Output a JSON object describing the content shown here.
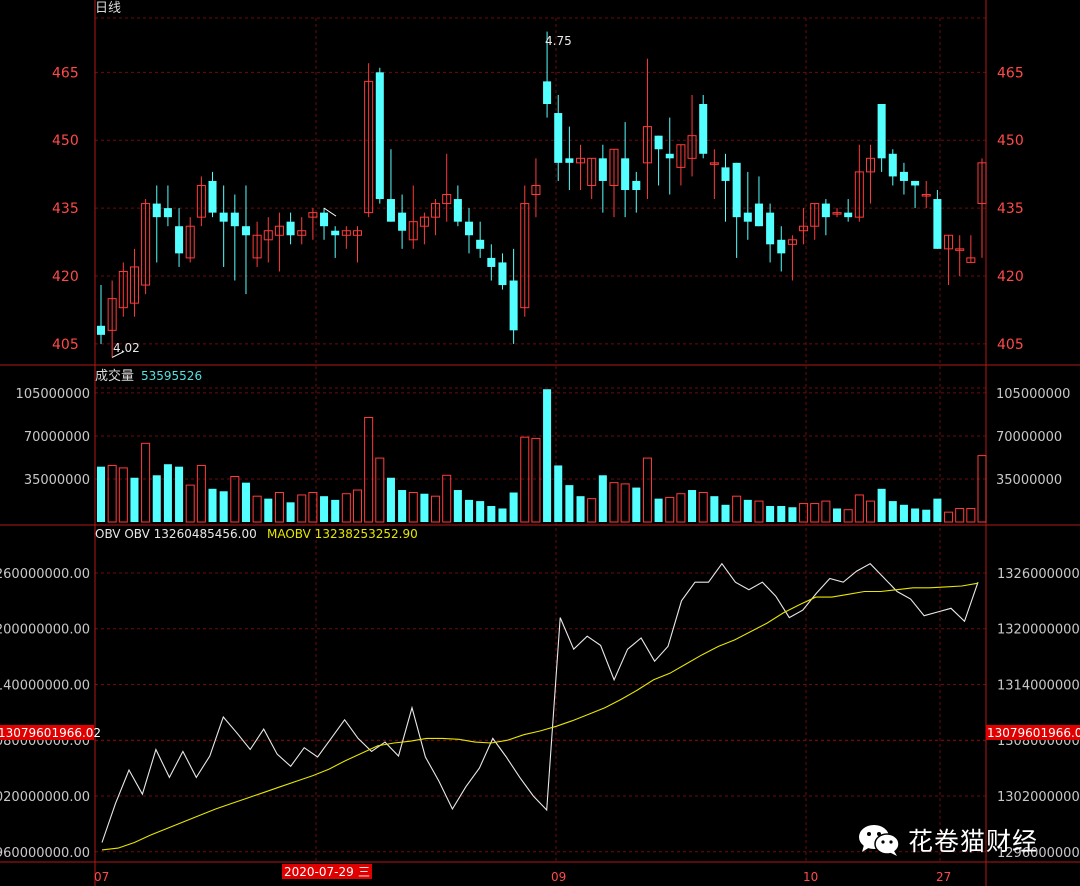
{
  "colors": {
    "up": "#ff3b3b",
    "down": "#54ffff",
    "frame": "#b01818",
    "grid": "#6a0c0c",
    "price_axis": "#ff4a4a",
    "vol_axis": "#c8c8c8",
    "obv_line": "#e8e8e8",
    "maobv_line": "#e6e600",
    "highlight_bg": "#e00000",
    "volume_value": "#54e0e0"
  },
  "price_panel": {
    "title": "日线",
    "high_marker": "4.75",
    "low_marker": "4.02"
  },
  "volume_panel": {
    "label": "成交量",
    "value": "53595526"
  },
  "obv_panel": {
    "label": "OBV OBV 13260485456.00",
    "ma_label": "MAOBV 13238253252.90",
    "highlight_left": "13079601966.02",
    "highlight_right": "13079601966.02"
  },
  "x_axis": {
    "labels": [
      "07",
      "09",
      "10",
      "27"
    ],
    "highlight_date": "2020-07-29",
    "highlight_weekday": "三"
  },
  "watermark": {
    "text": "花卷猫财经",
    "icon": "wechat-icon"
  },
  "chart_data": [
    {
      "type": "candlestick",
      "title": "日线",
      "y_ticks": [
        405,
        420,
        435,
        450,
        465
      ],
      "ylim": [
        401,
        477
      ],
      "grid": true,
      "annotations": [
        {
          "text": "4.75",
          "at_bar": 20
        },
        {
          "text": "4.02",
          "at_bar": 1
        }
      ],
      "candles": [
        {
          "o": 409,
          "h": 418,
          "l": 405,
          "c": 407
        },
        {
          "o": 408,
          "h": 419,
          "l": 402,
          "c": 415
        },
        {
          "o": 413,
          "h": 423,
          "l": 411,
          "c": 421
        },
        {
          "o": 414,
          "h": 426,
          "l": 411,
          "c": 422
        },
        {
          "o": 418,
          "h": 437,
          "l": 416,
          "c": 436
        },
        {
          "o": 436,
          "h": 440,
          "l": 423,
          "c": 433
        },
        {
          "o": 435,
          "h": 440,
          "l": 431,
          "c": 433
        },
        {
          "o": 431,
          "h": 435,
          "l": 422,
          "c": 425
        },
        {
          "o": 424,
          "h": 433,
          "l": 423,
          "c": 431
        },
        {
          "o": 433,
          "h": 442,
          "l": 431,
          "c": 440
        },
        {
          "o": 441,
          "h": 443,
          "l": 433,
          "c": 434
        },
        {
          "o": 434,
          "h": 440,
          "l": 422,
          "c": 432
        },
        {
          "o": 434,
          "h": 438,
          "l": 419,
          "c": 431
        },
        {
          "o": 431,
          "h": 440,
          "l": 416,
          "c": 429
        },
        {
          "o": 424,
          "h": 432,
          "l": 422,
          "c": 429
        },
        {
          "o": 428,
          "h": 433,
          "l": 423,
          "c": 430
        },
        {
          "o": 429,
          "h": 434,
          "l": 421,
          "c": 431
        },
        {
          "o": 432,
          "h": 434,
          "l": 427,
          "c": 429
        },
        {
          "o": 429,
          "h": 433,
          "l": 427,
          "c": 430
        },
        {
          "o": 433,
          "h": 435,
          "l": 428,
          "c": 434
        },
        {
          "o": 434,
          "h": 435,
          "l": 428,
          "c": 431
        },
        {
          "o": 430,
          "h": 431,
          "l": 424,
          "c": 429
        },
        {
          "o": 429,
          "h": 431,
          "l": 426,
          "c": 430
        },
        {
          "o": 429,
          "h": 431,
          "l": 423,
          "c": 430
        },
        {
          "o": 434,
          "h": 467,
          "l": 433,
          "c": 463
        },
        {
          "o": 465,
          "h": 466,
          "l": 436,
          "c": 437
        },
        {
          "o": 437,
          "h": 448,
          "l": 434,
          "c": 432
        },
        {
          "o": 434,
          "h": 438,
          "l": 426,
          "c": 430
        },
        {
          "o": 428,
          "h": 440,
          "l": 426,
          "c": 432
        },
        {
          "o": 431,
          "h": 434,
          "l": 427,
          "c": 433
        },
        {
          "o": 433,
          "h": 437,
          "l": 429,
          "c": 436
        },
        {
          "o": 436,
          "h": 447,
          "l": 432,
          "c": 438
        },
        {
          "o": 437,
          "h": 440,
          "l": 431,
          "c": 432
        },
        {
          "o": 432,
          "h": 435,
          "l": 425,
          "c": 429
        },
        {
          "o": 428,
          "h": 432,
          "l": 424,
          "c": 426
        },
        {
          "o": 424,
          "h": 427,
          "l": 419,
          "c": 422
        },
        {
          "o": 423,
          "h": 425,
          "l": 417,
          "c": 418
        },
        {
          "o": 419,
          "h": 426,
          "l": 405,
          "c": 408
        },
        {
          "o": 413,
          "h": 440,
          "l": 411,
          "c": 436
        },
        {
          "o": 438,
          "h": 446,
          "l": 433,
          "c": 440
        },
        {
          "o": 463,
          "h": 474,
          "l": 455,
          "c": 458
        },
        {
          "o": 456,
          "h": 460,
          "l": 441,
          "c": 445
        },
        {
          "o": 446,
          "h": 453,
          "l": 439,
          "c": 445
        },
        {
          "o": 445,
          "h": 449,
          "l": 439,
          "c": 446
        },
        {
          "o": 440,
          "h": 444,
          "l": 437,
          "c": 446
        },
        {
          "o": 446,
          "h": 449,
          "l": 434,
          "c": 441
        },
        {
          "o": 440,
          "h": 444,
          "l": 433,
          "c": 448
        },
        {
          "o": 446,
          "h": 454,
          "l": 433,
          "c": 439
        },
        {
          "o": 441,
          "h": 443,
          "l": 434,
          "c": 439
        },
        {
          "o": 445,
          "h": 468,
          "l": 437,
          "c": 453
        },
        {
          "o": 451,
          "h": 449,
          "l": 440,
          "c": 448
        },
        {
          "o": 447,
          "h": 455,
          "l": 438,
          "c": 446
        },
        {
          "o": 444,
          "h": 446,
          "l": 440,
          "c": 449
        },
        {
          "o": 446,
          "h": 460,
          "l": 442,
          "c": 451
        },
        {
          "o": 458,
          "h": 460,
          "l": 446,
          "c": 447
        },
        {
          "o": 445,
          "h": 448,
          "l": 437,
          "c": 445
        },
        {
          "o": 444,
          "h": 447,
          "l": 432,
          "c": 441
        },
        {
          "o": 445,
          "h": 445,
          "l": 424,
          "c": 433
        },
        {
          "o": 434,
          "h": 443,
          "l": 428,
          "c": 432
        },
        {
          "o": 436,
          "h": 442,
          "l": 432,
          "c": 431
        },
        {
          "o": 434,
          "h": 436,
          "l": 423,
          "c": 427
        },
        {
          "o": 428,
          "h": 431,
          "l": 421,
          "c": 425
        },
        {
          "o": 427,
          "h": 429,
          "l": 419,
          "c": 428
        },
        {
          "o": 430,
          "h": 435,
          "l": 427,
          "c": 431
        },
        {
          "o": 431,
          "h": 436,
          "l": 428,
          "c": 436
        },
        {
          "o": 436,
          "h": 437,
          "l": 429,
          "c": 433
        },
        {
          "o": 434,
          "h": 435,
          "l": 433,
          "c": 434
        },
        {
          "o": 434,
          "h": 437,
          "l": 432,
          "c": 433
        },
        {
          "o": 433,
          "h": 449,
          "l": 432,
          "c": 443
        },
        {
          "o": 443,
          "h": 449,
          "l": 436,
          "c": 446
        },
        {
          "o": 458,
          "h": 458,
          "l": 443,
          "c": 446
        },
        {
          "o": 447,
          "h": 448,
          "l": 440,
          "c": 442
        },
        {
          "o": 443,
          "h": 445,
          "l": 438,
          "c": 441
        },
        {
          "o": 441,
          "h": 438,
          "l": 435,
          "c": 440
        },
        {
          "o": 438,
          "h": 441,
          "l": 435,
          "c": 438
        },
        {
          "o": 437,
          "h": 439,
          "l": 427,
          "c": 426
        },
        {
          "o": 426,
          "h": 429,
          "l": 418,
          "c": 429
        },
        {
          "o": 426,
          "h": 429,
          "l": 420,
          "c": 426
        },
        {
          "o": 423,
          "h": 429,
          "l": 423,
          "c": 424
        },
        {
          "o": 436,
          "h": 446,
          "l": 424,
          "c": 445
        }
      ]
    },
    {
      "type": "bar",
      "title": "成交量",
      "y_ticks": [
        35000000,
        70000000,
        105000000
      ],
      "ylim": [
        0,
        109000000
      ],
      "bars": [
        {
          "v": 45000000,
          "d": "down"
        },
        {
          "v": 46000000,
          "d": "up"
        },
        {
          "v": 44000000,
          "d": "up"
        },
        {
          "v": 36000000,
          "d": "down"
        },
        {
          "v": 64000000,
          "d": "up"
        },
        {
          "v": 38000000,
          "d": "down"
        },
        {
          "v": 47000000,
          "d": "down"
        },
        {
          "v": 45000000,
          "d": "down"
        },
        {
          "v": 30000000,
          "d": "up"
        },
        {
          "v": 46000000,
          "d": "up"
        },
        {
          "v": 27000000,
          "d": "down"
        },
        {
          "v": 25000000,
          "d": "down"
        },
        {
          "v": 37000000,
          "d": "up"
        },
        {
          "v": 32000000,
          "d": "down"
        },
        {
          "v": 21000000,
          "d": "up"
        },
        {
          "v": 19000000,
          "d": "down"
        },
        {
          "v": 24000000,
          "d": "up"
        },
        {
          "v": 16000000,
          "d": "down"
        },
        {
          "v": 22000000,
          "d": "up"
        },
        {
          "v": 24000000,
          "d": "up"
        },
        {
          "v": 21000000,
          "d": "down"
        },
        {
          "v": 18000000,
          "d": "down"
        },
        {
          "v": 23000000,
          "d": "up"
        },
        {
          "v": 26000000,
          "d": "up"
        },
        {
          "v": 85000000,
          "d": "up"
        },
        {
          "v": 52000000,
          "d": "up"
        },
        {
          "v": 36000000,
          "d": "down"
        },
        {
          "v": 26000000,
          "d": "down"
        },
        {
          "v": 24000000,
          "d": "up"
        },
        {
          "v": 23000000,
          "d": "down"
        },
        {
          "v": 21000000,
          "d": "up"
        },
        {
          "v": 38000000,
          "d": "up"
        },
        {
          "v": 26000000,
          "d": "down"
        },
        {
          "v": 18000000,
          "d": "down"
        },
        {
          "v": 17000000,
          "d": "down"
        },
        {
          "v": 13000000,
          "d": "down"
        },
        {
          "v": 11000000,
          "d": "down"
        },
        {
          "v": 24000000,
          "d": "down"
        },
        {
          "v": 69000000,
          "d": "up"
        },
        {
          "v": 68000000,
          "d": "up"
        },
        {
          "v": 108000000,
          "d": "down"
        },
        {
          "v": 46000000,
          "d": "down"
        },
        {
          "v": 30000000,
          "d": "down"
        },
        {
          "v": 21000000,
          "d": "down"
        },
        {
          "v": 19000000,
          "d": "up"
        },
        {
          "v": 38000000,
          "d": "down"
        },
        {
          "v": 32000000,
          "d": "up"
        },
        {
          "v": 31000000,
          "d": "up"
        },
        {
          "v": 28000000,
          "d": "down"
        },
        {
          "v": 52000000,
          "d": "up"
        },
        {
          "v": 19000000,
          "d": "down"
        },
        {
          "v": 20000000,
          "d": "up"
        },
        {
          "v": 23000000,
          "d": "up"
        },
        {
          "v": 26000000,
          "d": "down"
        },
        {
          "v": 24000000,
          "d": "up"
        },
        {
          "v": 21000000,
          "d": "down"
        },
        {
          "v": 14000000,
          "d": "down"
        },
        {
          "v": 21000000,
          "d": "up"
        },
        {
          "v": 18000000,
          "d": "down"
        },
        {
          "v": 17000000,
          "d": "up"
        },
        {
          "v": 13000000,
          "d": "down"
        },
        {
          "v": 13000000,
          "d": "down"
        },
        {
          "v": 12000000,
          "d": "down"
        },
        {
          "v": 15000000,
          "d": "up"
        },
        {
          "v": 15000000,
          "d": "up"
        },
        {
          "v": 17000000,
          "d": "up"
        },
        {
          "v": 11000000,
          "d": "down"
        },
        {
          "v": 10000000,
          "d": "up"
        },
        {
          "v": 22000000,
          "d": "up"
        },
        {
          "v": 17000000,
          "d": "up"
        },
        {
          "v": 27000000,
          "d": "down"
        },
        {
          "v": 17000000,
          "d": "down"
        },
        {
          "v": 14000000,
          "d": "down"
        },
        {
          "v": 11000000,
          "d": "down"
        },
        {
          "v": 10000000,
          "d": "down"
        },
        {
          "v": 19000000,
          "d": "down"
        },
        {
          "v": 8000000,
          "d": "up"
        },
        {
          "v": 11000000,
          "d": "up"
        },
        {
          "v": 11000000,
          "d": "up"
        },
        {
          "v": 54000000,
          "d": "up"
        }
      ]
    },
    {
      "type": "line",
      "title": "OBV",
      "y_ticks": [
        12960000000,
        13020000000,
        13080000000,
        13140000000,
        13200000000,
        13260000000
      ],
      "ylim": [
        12949000000,
        13289000000
      ],
      "highlight_value": 13079601966.02,
      "series": [
        {
          "name": "OBV",
          "values": [
            12970000000,
            13012000000,
            13048000000,
            13022000000,
            13070000000,
            13040000000,
            13068000000,
            13040000000,
            13063000000,
            13105000000,
            13088000000,
            13070000000,
            13092000000,
            13065000000,
            13052000000,
            13072000000,
            13062000000,
            13082000000,
            13102000000,
            13082000000,
            13068000000,
            13078000000,
            13063000000,
            13115000000,
            13062000000,
            13036000000,
            13006000000,
            13030000000,
            13050000000,
            13082000000,
            13062000000,
            13040000000,
            13020000000,
            13005000000,
            13212000000,
            13178000000,
            13192000000,
            13182000000,
            13145000000,
            13178000000,
            13190000000,
            13165000000,
            13181000000,
            13230000000,
            13250000000,
            13250000000,
            13270000000,
            13250000000,
            13242000000,
            13250000000,
            13235000000,
            13212000000,
            13220000000,
            13238000000,
            13254000000,
            13250000000,
            13262000000,
            13270000000,
            13255000000,
            13240000000,
            13232000000,
            13214000000,
            13218000000,
            13222000000,
            13208000000,
            13250000000
          ]
        },
        {
          "name": "MAOBV",
          "values": [
            12962000000,
            12964000000,
            12970000000,
            12978000000,
            12985000000,
            12992000000,
            12999000000,
            13006000000,
            13012000000,
            13018000000,
            13024000000,
            13030000000,
            13036000000,
            13042000000,
            13049000000,
            13058000000,
            13066000000,
            13074000000,
            13077000000,
            13079000000,
            13082000000,
            13082000000,
            13081000000,
            13078000000,
            13077000000,
            13080000000,
            13086000000,
            13090000000,
            13095000000,
            13101000000,
            13108000000,
            13115000000,
            13124000000,
            13134000000,
            13145000000,
            13152000000,
            13162000000,
            13172000000,
            13181000000,
            13188000000,
            13197000000,
            13206000000,
            13217000000,
            13226000000,
            13234000000,
            13234000000,
            13237000000,
            13240000000,
            13240000000,
            13242000000,
            13244000000,
            13244000000,
            13245000000,
            13246000000,
            13249000000
          ]
        }
      ]
    }
  ]
}
